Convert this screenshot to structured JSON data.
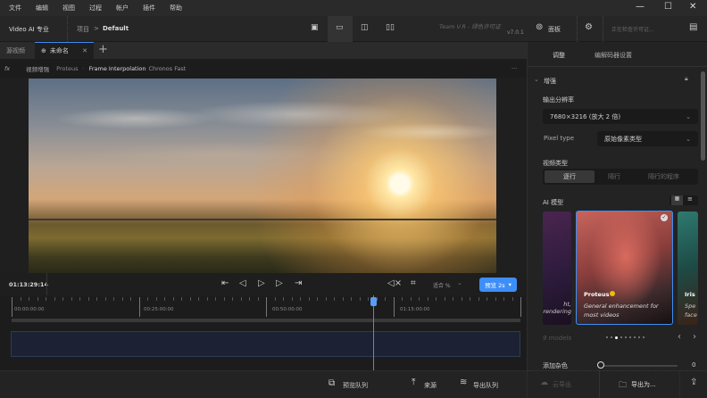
{
  "menu": [
    "文件",
    "编辑",
    "视图",
    "过程",
    "帐户",
    "插件",
    "帮助"
  ],
  "window_controls": {
    "minimize": "—",
    "maximize": "☐",
    "close": "✕"
  },
  "header": {
    "app_name": "Video AI 专业",
    "breadcrumb_root": "项目",
    "breadcrumb_sep": ">",
    "breadcrumb_current": "Default",
    "watermark": "Team V.R - 绿色许可证",
    "version": "v7.0.1",
    "user_label": "面板",
    "search_placeholder": "正在检查许可证..."
  },
  "tabs": [
    {
      "label": "源视频"
    },
    {
      "label": "未命名",
      "active": true,
      "close": "✕"
    }
  ],
  "tab_add": "+",
  "crumbs": {
    "fx": "fx",
    "enhance": "视频增强",
    "model": "Proteus",
    "dot": "·",
    "interp": "Frame Interpolation",
    "interp_model": "Chronos Fast",
    "more": "···"
  },
  "controls": {
    "timecode": "01:13:29:14",
    "zoom": "适合 %",
    "preview_button": "预览 2s",
    "preview_caret": "▾"
  },
  "timeline": {
    "ticks": [
      "00:00:00:00",
      "00:25:00:00",
      "00:50:00:00",
      "01:15:00:00"
    ],
    "playhead_fraction": 0.71
  },
  "bottom": {
    "preview_queue": "预览队列",
    "source": "来源",
    "export_queue": "导出队列"
  },
  "right": {
    "tabs": [
      "调整",
      "编解码器设置"
    ],
    "section": "增强",
    "output_res_label": "输出分辨率",
    "output_res_value": "7680×3216 (放大 2 倍)",
    "pixel_type_label": "Pixel type",
    "pixel_type_value": "原始像素类型",
    "video_type_label": "视频类型",
    "video_types": [
      "逐行",
      "隔行",
      "隔行的程序"
    ],
    "ai_model_label": "AI 模型",
    "cards": [
      {
        "name": "",
        "desc": "ht, rendering"
      },
      {
        "name": "Proteus",
        "desc": "General enhancement for most videos",
        "selected": true
      },
      {
        "name": "Iris",
        "desc": "Spe face"
      }
    ],
    "models_count": "9 models",
    "carousel_active": 3,
    "carousel_total": 9,
    "grain_label": "添加杂色",
    "grain_value": "0",
    "grain_fraction": 0,
    "cloud_export": "云导出",
    "export_as": "导出为..."
  },
  "colors": {
    "accent": "#3e8ef7",
    "badge": "#f2b90c"
  }
}
